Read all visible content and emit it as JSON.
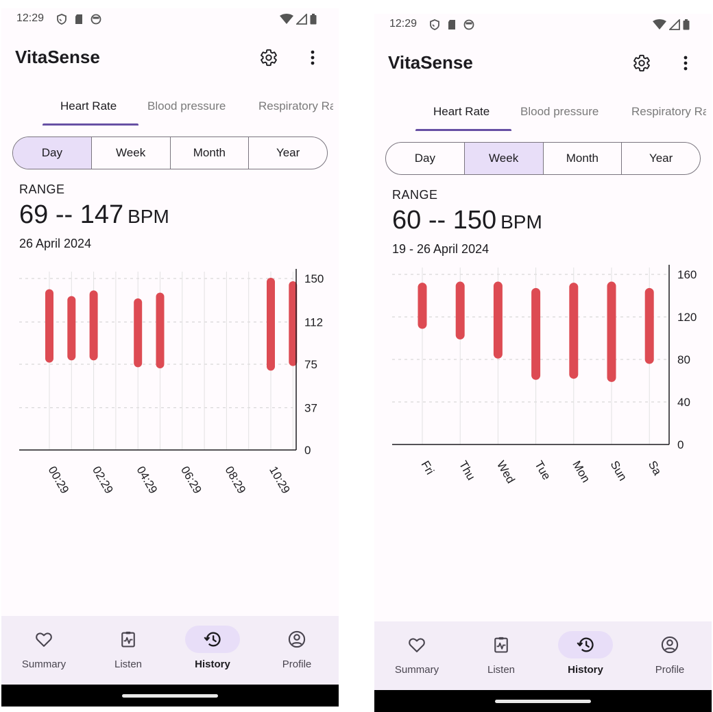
{
  "screens": [
    {
      "status": {
        "time": "12:29"
      },
      "app_title": "VitaSense",
      "tabs": [
        {
          "label": "Heart Rate",
          "active": true
        },
        {
          "label": "Blood pressure",
          "active": false
        },
        {
          "label": "Respiratory Ra",
          "active": false
        }
      ],
      "periods": [
        {
          "label": "Day",
          "selected": true
        },
        {
          "label": "Week",
          "selected": false
        },
        {
          "label": "Month",
          "selected": false
        },
        {
          "label": "Year",
          "selected": false
        }
      ],
      "range": {
        "label": "RANGE",
        "value": "69 -- 147",
        "unit": "BPM",
        "date": "26 April 2024"
      },
      "nav": [
        {
          "label": "Summary",
          "icon": "heart-icon",
          "active": false
        },
        {
          "label": "Listen",
          "icon": "clipboard-pulse-icon",
          "active": false
        },
        {
          "label": "History",
          "icon": "history-icon",
          "active": true
        },
        {
          "label": "Profile",
          "icon": "profile-icon",
          "active": false
        }
      ]
    },
    {
      "status": {
        "time": "12:29"
      },
      "app_title": "VitaSense",
      "tabs": [
        {
          "label": "Heart Rate",
          "active": true
        },
        {
          "label": "Blood pressure",
          "active": false
        },
        {
          "label": "Respiratory Ra",
          "active": false
        }
      ],
      "periods": [
        {
          "label": "Day",
          "selected": false
        },
        {
          "label": "Week",
          "selected": true
        },
        {
          "label": "Month",
          "selected": false
        },
        {
          "label": "Year",
          "selected": false
        }
      ],
      "range": {
        "label": "RANGE",
        "value": "60 -- 150",
        "unit": "BPM",
        "date": "19 - 26 April 2024"
      },
      "nav": [
        {
          "label": "Summary",
          "icon": "heart-icon",
          "active": false
        },
        {
          "label": "Listen",
          "icon": "clipboard-pulse-icon",
          "active": false
        },
        {
          "label": "History",
          "icon": "history-icon",
          "active": true
        },
        {
          "label": "Profile",
          "icon": "profile-icon",
          "active": false
        }
      ]
    }
  ],
  "chart_data": [
    {
      "type": "bar",
      "subtype": "floating-range",
      "bar_color": "#dd4b53",
      "ylim": [
        0,
        150
      ],
      "y_ticks": [
        "0",
        "37",
        "75",
        "112",
        "150"
      ],
      "y_axis_side": "right",
      "x_tick_labels": [
        "00:29",
        "02:29",
        "04:29",
        "06:29",
        "08:29",
        "10:29"
      ],
      "slot_count": 12,
      "bars": [
        {
          "slot": 0,
          "min": 80,
          "max": 137
        },
        {
          "slot": 1,
          "min": 82,
          "max": 131
        },
        {
          "slot": 2,
          "min": 82,
          "max": 136
        },
        {
          "slot": 4,
          "min": 76,
          "max": 129
        },
        {
          "slot": 5,
          "min": 75,
          "max": 134
        },
        {
          "slot": 10,
          "min": 73,
          "max": 147
        },
        {
          "slot": 11,
          "min": 77,
          "max": 144
        }
      ]
    },
    {
      "type": "bar",
      "subtype": "floating-range",
      "bar_color": "#dd4b53",
      "ylim": [
        0,
        160
      ],
      "y_ticks": [
        "0",
        "40",
        "80",
        "120",
        "160"
      ],
      "y_axis_side": "right",
      "x_tick_labels": [
        "Fri",
        "Thu",
        "Wed",
        "Tue",
        "Mon",
        "Sun",
        "Sa"
      ],
      "categories": [
        "Fri",
        "Thu",
        "Wed",
        "Tue",
        "Mon",
        "Sun",
        "Sa"
      ],
      "bars": [
        {
          "min": 113,
          "max": 148
        },
        {
          "min": 103,
          "max": 149
        },
        {
          "min": 85,
          "max": 149
        },
        {
          "min": 65,
          "max": 143
        },
        {
          "min": 66,
          "max": 148
        },
        {
          "min": 63,
          "max": 149
        },
        {
          "min": 80,
          "max": 143
        }
      ]
    }
  ]
}
